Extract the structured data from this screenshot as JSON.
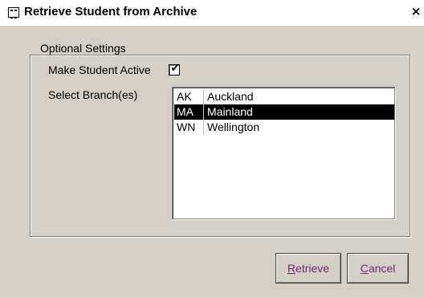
{
  "window": {
    "title": "Retrieve Student from Archive",
    "close_glyph": "×",
    "icon": "form-icon"
  },
  "group": {
    "legend": "Optional Settings"
  },
  "settings": {
    "make_active_label": "Make Student Active",
    "make_active_checked": true,
    "check_glyph": "✔",
    "branch_label": "Select Branch(es)"
  },
  "branches": [
    {
      "code": "AK",
      "name": "Auckland",
      "selected": false
    },
    {
      "code": "MA",
      "name": "Mainland",
      "selected": true
    },
    {
      "code": "WN",
      "name": "Wellington",
      "selected": false
    }
  ],
  "buttons": {
    "retrieve": {
      "accel": "R",
      "rest": "etrieve"
    },
    "cancel": {
      "accel": "C",
      "rest": "ancel"
    }
  },
  "colors": {
    "face": "#d4d0c8",
    "selection_bg": "#000000",
    "selection_fg": "#ffffff",
    "button_text": "#6b2e6b"
  }
}
